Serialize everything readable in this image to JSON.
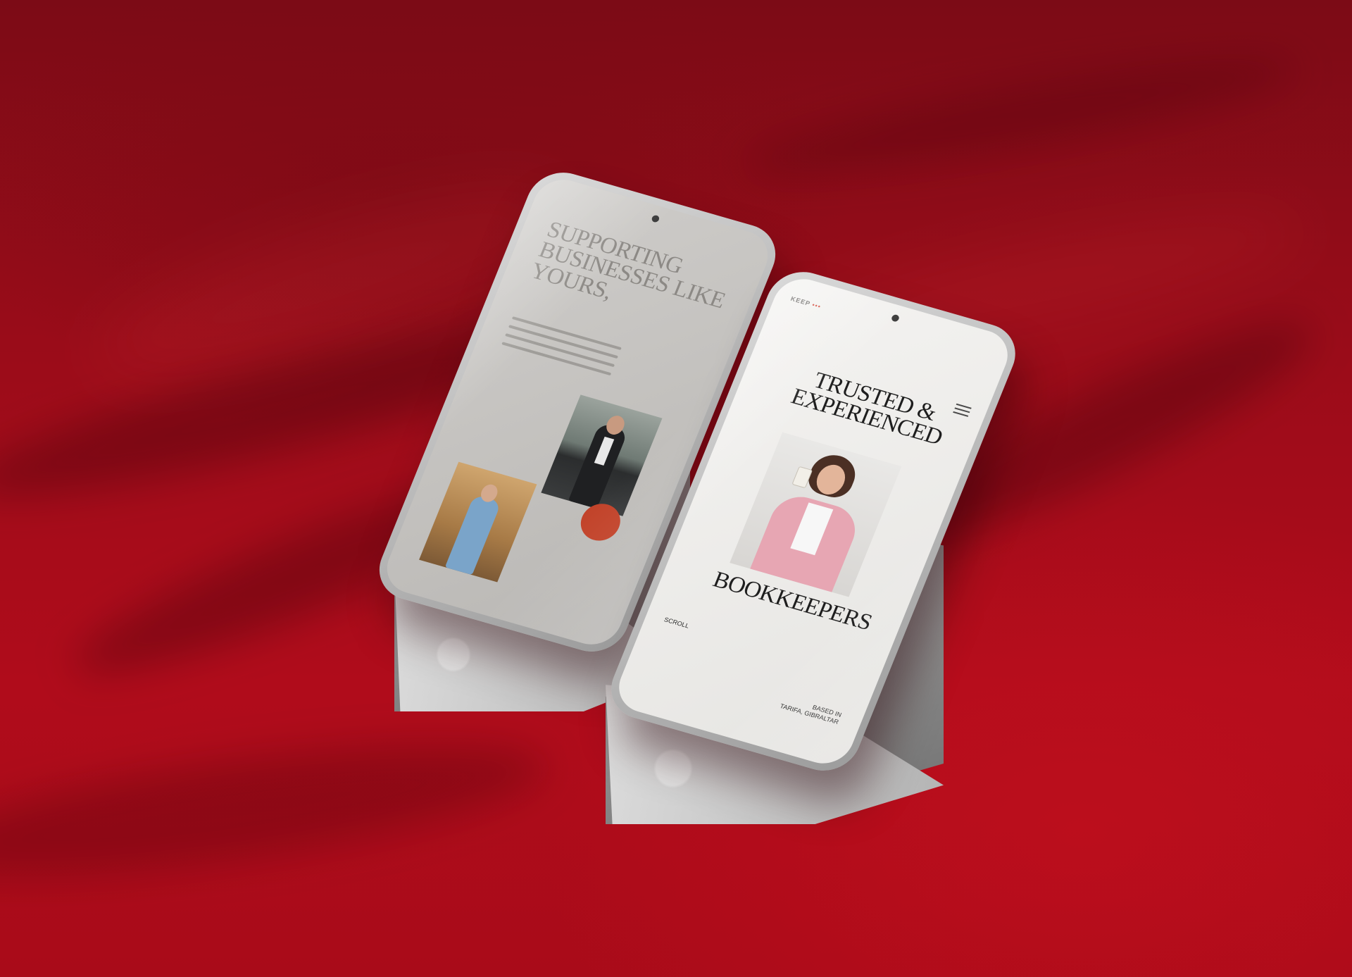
{
  "background": {
    "color": "#a80c1a"
  },
  "left_phone": {
    "headline": "SUPPORTING BUSINESSES LIKE YOURS,",
    "accent_color": "#c2432a"
  },
  "right_phone": {
    "logo": "KEEP",
    "logo_accent": "•••",
    "headline": "TRUSTED & EXPERIENCED",
    "headline_bottom": "BOOKKEEPERS",
    "scroll_label": "SCROLL",
    "location_line1": "BASED IN",
    "location_line2": "TARIFA, GIBRALTAR",
    "menu_icon": "hamburger-icon"
  }
}
